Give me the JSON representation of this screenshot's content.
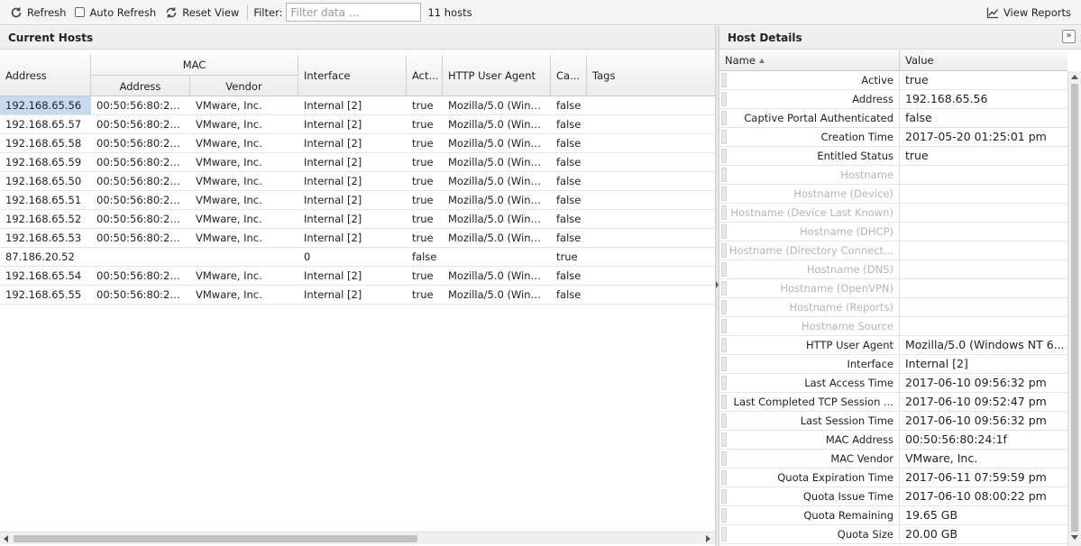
{
  "toolbar": {
    "refresh_label": "Refresh",
    "auto_refresh_label": "Auto Refresh",
    "reset_view_label": "Reset View",
    "filter_label": "Filter:",
    "filter_placeholder": "Filter data ...",
    "host_count": "11 hosts",
    "view_reports_label": "View Reports"
  },
  "hosts_panel": {
    "title": "Current Hosts",
    "columns": {
      "address": "Address",
      "mac_group": "MAC",
      "mac_address": "Address",
      "mac_vendor": "Vendor",
      "interface": "Interface",
      "active": "Act...",
      "http_user_agent": "HTTP User Agent",
      "captive": "Ca...",
      "tags": "Tags"
    },
    "rows": [
      {
        "address": "192.168.65.56",
        "mac": "00:50:56:80:24...",
        "vendor": "VMware, Inc.",
        "interface": "Internal [2]",
        "active": "true",
        "agent": "Mozilla/5.0 (Windo...",
        "captive": "false",
        "tags": ""
      },
      {
        "address": "192.168.65.57",
        "mac": "00:50:56:80:24...",
        "vendor": "VMware, Inc.",
        "interface": "Internal [2]",
        "active": "true",
        "agent": "Mozilla/5.0 (Windo...",
        "captive": "false",
        "tags": ""
      },
      {
        "address": "192.168.65.58",
        "mac": "00:50:56:80:24...",
        "vendor": "VMware, Inc.",
        "interface": "Internal [2]",
        "active": "true",
        "agent": "Mozilla/5.0 (Windo...",
        "captive": "false",
        "tags": ""
      },
      {
        "address": "192.168.65.59",
        "mac": "00:50:56:80:24...",
        "vendor": "VMware, Inc.",
        "interface": "Internal [2]",
        "active": "true",
        "agent": "Mozilla/5.0 (Windo...",
        "captive": "false",
        "tags": ""
      },
      {
        "address": "192.168.65.50",
        "mac": "00:50:56:80:24...",
        "vendor": "VMware, Inc.",
        "interface": "Internal [2]",
        "active": "true",
        "agent": "Mozilla/5.0 (Windo...",
        "captive": "false",
        "tags": ""
      },
      {
        "address": "192.168.65.51",
        "mac": "00:50:56:80:24...",
        "vendor": "VMware, Inc.",
        "interface": "Internal [2]",
        "active": "true",
        "agent": "Mozilla/5.0 (Windo...",
        "captive": "false",
        "tags": ""
      },
      {
        "address": "192.168.65.52",
        "mac": "00:50:56:80:24...",
        "vendor": "VMware, Inc.",
        "interface": "Internal [2]",
        "active": "true",
        "agent": "Mozilla/5.0 (Windo...",
        "captive": "false",
        "tags": ""
      },
      {
        "address": "192.168.65.53",
        "mac": "00:50:56:80:24...",
        "vendor": "VMware, Inc.",
        "interface": "Internal [2]",
        "active": "true",
        "agent": "Mozilla/5.0 (Windo...",
        "captive": "false",
        "tags": ""
      },
      {
        "address": "87.186.20.52",
        "mac": "",
        "vendor": "",
        "interface": "0",
        "active": "false",
        "agent": "",
        "captive": "true",
        "tags": ""
      },
      {
        "address": "192.168.65.54",
        "mac": "00:50:56:80:24...",
        "vendor": "VMware, Inc.",
        "interface": "Internal [2]",
        "active": "true",
        "agent": "Mozilla/5.0 (Windo...",
        "captive": "false",
        "tags": ""
      },
      {
        "address": "192.168.65.55",
        "mac": "00:50:56:80:24...",
        "vendor": "VMware, Inc.",
        "interface": "Internal [2]",
        "active": "true",
        "agent": "Mozilla/5.0 (Windo...",
        "captive": "false",
        "tags": ""
      }
    ]
  },
  "details_panel": {
    "title": "Host Details",
    "collapse_glyph": "»",
    "name_header": "Name",
    "value_header": "Value",
    "rows": [
      {
        "name": "Active",
        "value": "true",
        "dim": false
      },
      {
        "name": "Address",
        "value": "192.168.65.56",
        "dim": false
      },
      {
        "name": "Captive Portal Authenticated",
        "value": "false",
        "dim": false
      },
      {
        "name": "Creation Time",
        "value": "2017-05-20 01:25:01 pm",
        "dim": false
      },
      {
        "name": "Entitled Status",
        "value": "true",
        "dim": false
      },
      {
        "name": "Hostname",
        "value": "",
        "dim": true
      },
      {
        "name": "Hostname (Device)",
        "value": "",
        "dim": true
      },
      {
        "name": "Hostname (Device Last Known)",
        "value": "",
        "dim": true
      },
      {
        "name": "Hostname (DHCP)",
        "value": "",
        "dim": true
      },
      {
        "name": "Hostname (Directory Connect...",
        "value": "",
        "dim": true
      },
      {
        "name": "Hostname (DNS)",
        "value": "",
        "dim": true
      },
      {
        "name": "Hostname (OpenVPN)",
        "value": "",
        "dim": true
      },
      {
        "name": "Hostname (Reports)",
        "value": "",
        "dim": true
      },
      {
        "name": "Hostname Source",
        "value": "",
        "dim": true
      },
      {
        "name": "HTTP User Agent",
        "value": "Mozilla/5.0 (Windows NT 6...",
        "dim": false
      },
      {
        "name": "Interface",
        "value": "Internal [2]",
        "dim": false
      },
      {
        "name": "Last Access Time",
        "value": "2017-06-10 09:56:32 pm",
        "dim": false
      },
      {
        "name": "Last Completed TCP Session ...",
        "value": "2017-06-10 09:52:47 pm",
        "dim": false
      },
      {
        "name": "Last Session Time",
        "value": "2017-06-10 09:56:32 pm",
        "dim": false
      },
      {
        "name": "MAC Address",
        "value": "00:50:56:80:24:1f",
        "dim": false
      },
      {
        "name": "MAC Vendor",
        "value": "VMware, Inc.",
        "dim": false
      },
      {
        "name": "Quota Expiration Time",
        "value": "2017-06-11 07:59:59 pm",
        "dim": false
      },
      {
        "name": "Quota Issue Time",
        "value": "2017-06-10 08:00:22 pm",
        "dim": false
      },
      {
        "name": "Quota Remaining",
        "value": "19.65 GB",
        "dim": false
      },
      {
        "name": "Quota Size",
        "value": "20.00 GB",
        "dim": false
      }
    ]
  },
  "colors": {
    "selected_cell": "#c6dbf2",
    "dim_text": "#b5b5b5"
  }
}
